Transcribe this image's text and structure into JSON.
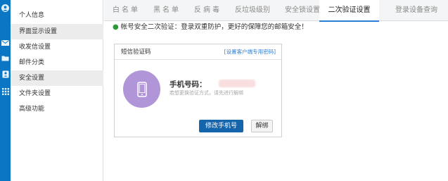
{
  "sidebar": {
    "items": [
      {
        "label": "个人信息",
        "active": false
      },
      {
        "label": "界面显示设置",
        "active": true
      },
      {
        "label": "收发信设置",
        "active": false
      },
      {
        "label": "邮件分类",
        "active": false
      },
      {
        "label": "安全设置",
        "active": true
      },
      {
        "label": "文件夹设置",
        "active": false
      },
      {
        "label": "高级功能",
        "active": false
      }
    ]
  },
  "tabs": [
    {
      "label": "白名单",
      "active": false
    },
    {
      "label": "黑名单",
      "active": false
    },
    {
      "label": "反病毒",
      "active": false
    },
    {
      "label": "反垃圾级别",
      "active": false
    },
    {
      "label": "安全锁设置",
      "active": false
    },
    {
      "label": "二次验证设置",
      "active": true
    },
    {
      "label": "登录设备查询",
      "active": false
    }
  ],
  "notice": {
    "text": "帐号安全二次验证：登录双重防护，更好的保障您的邮箱安全！"
  },
  "card": {
    "title": "短信验证码",
    "link": "[设置客户端专用密码]",
    "phone_label": "手机号码：",
    "hint": "若想更换验证方式，请先进行解绑",
    "primary_button": "修改手机号",
    "secondary_button": "解绑"
  },
  "colors": {
    "rail": "#0b76c4",
    "accent": "#2b7fd6",
    "primary_button": "#1565ad",
    "phone_icon_bg": "#b095d8",
    "notice_dot": "#2a9a3a"
  },
  "icons": {
    "rail": [
      "avatar-icon",
      "mail-icon",
      "folder-icon",
      "contacts-icon",
      "apps-grid-icon"
    ],
    "card": "mobile-phone-icon"
  }
}
